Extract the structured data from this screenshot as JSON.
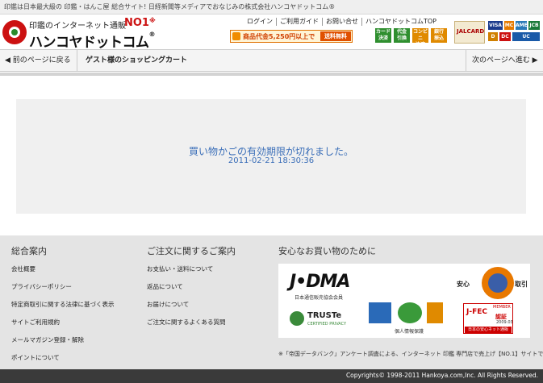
{
  "topstrip": {
    "text": "印鑑は日本最大級の 印鑑・はんこ屋 総合サイト! 日経新聞等メディアでおなじみの株式会社ハンコヤドットコム®"
  },
  "header": {
    "logo_tagline": "印鑑のインターネット通販",
    "logo_no1": "NO1",
    "logo_no1_mark": "※",
    "logo_main": "ハンコヤドットコム",
    "logo_reg": "®",
    "nav": [
      "ログイン",
      "ご利用ガイド",
      "お問い合せ",
      "ハンコヤドットコムTOP"
    ],
    "promo_text": "商品代金5,250円以上で",
    "promo_free": "送料無料",
    "payments": [
      [
        "カード",
        "決済"
      ],
      [
        "代金",
        "引換"
      ],
      [
        "コンビニ",
        "決済"
      ],
      [
        "銀行",
        "振込"
      ]
    ],
    "jalcard_text": "JALCARD",
    "cards": [
      "VISA",
      "MC",
      "AMEX",
      "JCB",
      "D",
      "DC",
      "UC"
    ]
  },
  "subbar": {
    "back_label": "◀ 前のページに戻る",
    "title": "ゲスト様のショッピングカート",
    "next_label": "次のページへ進む ▶"
  },
  "message": {
    "line1": "買い物かごの有効期限が切れました。",
    "line2": "2011-02-21 18:30:36"
  },
  "footer": {
    "col1": {
      "heading": "総合案内",
      "items": [
        "会社概要",
        "プライバシーポリシー",
        "特定商取引に関する法律に基づく表示",
        "サイトご利用規約",
        "メールマガジン登録・解除",
        "ポイントについて"
      ]
    },
    "col2": {
      "heading": "ご注文に関するご案内",
      "items": [
        "お支払い・送料について",
        "返品について",
        "お届けについて",
        "ご注文に関するよくある質問"
      ]
    },
    "col3": {
      "heading": "安心なお買い物のために",
      "jdma": "J•DMA",
      "jdma_caption": "日本通信販売協会会員",
      "truste_word": "TRUSTe",
      "truste_sub": "CERTIFIED PRIVACY",
      "pmark_caption": "個人情報保護",
      "seal_left": "安心",
      "seal_right": "取引",
      "jfec_word": "J-FEC",
      "jfec_member": "MEMBER",
      "jfec_cert": "認証",
      "jfec_date": "2009.03",
      "jfec_banner": "日本の安心ネット通販"
    },
    "note": "※「帝国データバンク」アンケート調査による、インターネット 印鑑 専門店で売上げ【NO.1】サイトです。",
    "copyright": "Copyrights© 1998-2011 Hankoya.com,Inc. All Rights Reserved."
  },
  "colors": {
    "brand_red": "#cc1111",
    "message_blue": "#3a6eb8",
    "footer_gray": "#e4e4e4",
    "payment_green": "#2f8f2f"
  }
}
